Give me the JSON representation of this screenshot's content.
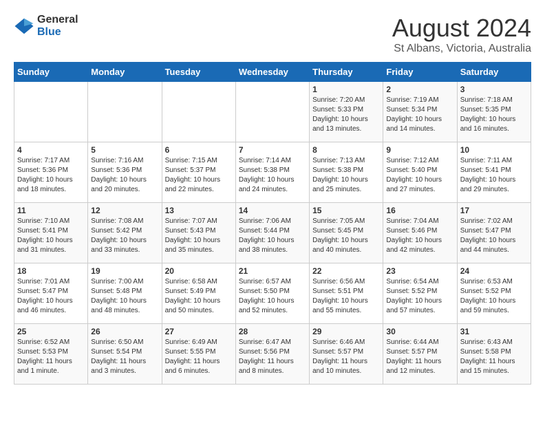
{
  "header": {
    "logo_general": "General",
    "logo_blue": "Blue",
    "month": "August 2024",
    "location": "St Albans, Victoria, Australia"
  },
  "weekdays": [
    "Sunday",
    "Monday",
    "Tuesday",
    "Wednesday",
    "Thursday",
    "Friday",
    "Saturday"
  ],
  "weeks": [
    [
      {
        "day": "",
        "info": ""
      },
      {
        "day": "",
        "info": ""
      },
      {
        "day": "",
        "info": ""
      },
      {
        "day": "",
        "info": ""
      },
      {
        "day": "1",
        "info": "Sunrise: 7:20 AM\nSunset: 5:33 PM\nDaylight: 10 hours\nand 13 minutes."
      },
      {
        "day": "2",
        "info": "Sunrise: 7:19 AM\nSunset: 5:34 PM\nDaylight: 10 hours\nand 14 minutes."
      },
      {
        "day": "3",
        "info": "Sunrise: 7:18 AM\nSunset: 5:35 PM\nDaylight: 10 hours\nand 16 minutes."
      }
    ],
    [
      {
        "day": "4",
        "info": "Sunrise: 7:17 AM\nSunset: 5:36 PM\nDaylight: 10 hours\nand 18 minutes."
      },
      {
        "day": "5",
        "info": "Sunrise: 7:16 AM\nSunset: 5:36 PM\nDaylight: 10 hours\nand 20 minutes."
      },
      {
        "day": "6",
        "info": "Sunrise: 7:15 AM\nSunset: 5:37 PM\nDaylight: 10 hours\nand 22 minutes."
      },
      {
        "day": "7",
        "info": "Sunrise: 7:14 AM\nSunset: 5:38 PM\nDaylight: 10 hours\nand 24 minutes."
      },
      {
        "day": "8",
        "info": "Sunrise: 7:13 AM\nSunset: 5:38 PM\nDaylight: 10 hours\nand 25 minutes."
      },
      {
        "day": "9",
        "info": "Sunrise: 7:12 AM\nSunset: 5:40 PM\nDaylight: 10 hours\nand 27 minutes."
      },
      {
        "day": "10",
        "info": "Sunrise: 7:11 AM\nSunset: 5:41 PM\nDaylight: 10 hours\nand 29 minutes."
      }
    ],
    [
      {
        "day": "11",
        "info": "Sunrise: 7:10 AM\nSunset: 5:41 PM\nDaylight: 10 hours\nand 31 minutes."
      },
      {
        "day": "12",
        "info": "Sunrise: 7:08 AM\nSunset: 5:42 PM\nDaylight: 10 hours\nand 33 minutes."
      },
      {
        "day": "13",
        "info": "Sunrise: 7:07 AM\nSunset: 5:43 PM\nDaylight: 10 hours\nand 35 minutes."
      },
      {
        "day": "14",
        "info": "Sunrise: 7:06 AM\nSunset: 5:44 PM\nDaylight: 10 hours\nand 38 minutes."
      },
      {
        "day": "15",
        "info": "Sunrise: 7:05 AM\nSunset: 5:45 PM\nDaylight: 10 hours\nand 40 minutes."
      },
      {
        "day": "16",
        "info": "Sunrise: 7:04 AM\nSunset: 5:46 PM\nDaylight: 10 hours\nand 42 minutes."
      },
      {
        "day": "17",
        "info": "Sunrise: 7:02 AM\nSunset: 5:47 PM\nDaylight: 10 hours\nand 44 minutes."
      }
    ],
    [
      {
        "day": "18",
        "info": "Sunrise: 7:01 AM\nSunset: 5:47 PM\nDaylight: 10 hours\nand 46 minutes."
      },
      {
        "day": "19",
        "info": "Sunrise: 7:00 AM\nSunset: 5:48 PM\nDaylight: 10 hours\nand 48 minutes."
      },
      {
        "day": "20",
        "info": "Sunrise: 6:58 AM\nSunset: 5:49 PM\nDaylight: 10 hours\nand 50 minutes."
      },
      {
        "day": "21",
        "info": "Sunrise: 6:57 AM\nSunset: 5:50 PM\nDaylight: 10 hours\nand 52 minutes."
      },
      {
        "day": "22",
        "info": "Sunrise: 6:56 AM\nSunset: 5:51 PM\nDaylight: 10 hours\nand 55 minutes."
      },
      {
        "day": "23",
        "info": "Sunrise: 6:54 AM\nSunset: 5:52 PM\nDaylight: 10 hours\nand 57 minutes."
      },
      {
        "day": "24",
        "info": "Sunrise: 6:53 AM\nSunset: 5:52 PM\nDaylight: 10 hours\nand 59 minutes."
      }
    ],
    [
      {
        "day": "25",
        "info": "Sunrise: 6:52 AM\nSunset: 5:53 PM\nDaylight: 11 hours\nand 1 minute."
      },
      {
        "day": "26",
        "info": "Sunrise: 6:50 AM\nSunset: 5:54 PM\nDaylight: 11 hours\nand 3 minutes."
      },
      {
        "day": "27",
        "info": "Sunrise: 6:49 AM\nSunset: 5:55 PM\nDaylight: 11 hours\nand 6 minutes."
      },
      {
        "day": "28",
        "info": "Sunrise: 6:47 AM\nSunset: 5:56 PM\nDaylight: 11 hours\nand 8 minutes."
      },
      {
        "day": "29",
        "info": "Sunrise: 6:46 AM\nSunset: 5:57 PM\nDaylight: 11 hours\nand 10 minutes."
      },
      {
        "day": "30",
        "info": "Sunrise: 6:44 AM\nSunset: 5:57 PM\nDaylight: 11 hours\nand 12 minutes."
      },
      {
        "day": "31",
        "info": "Sunrise: 6:43 AM\nSunset: 5:58 PM\nDaylight: 11 hours\nand 15 minutes."
      }
    ]
  ]
}
